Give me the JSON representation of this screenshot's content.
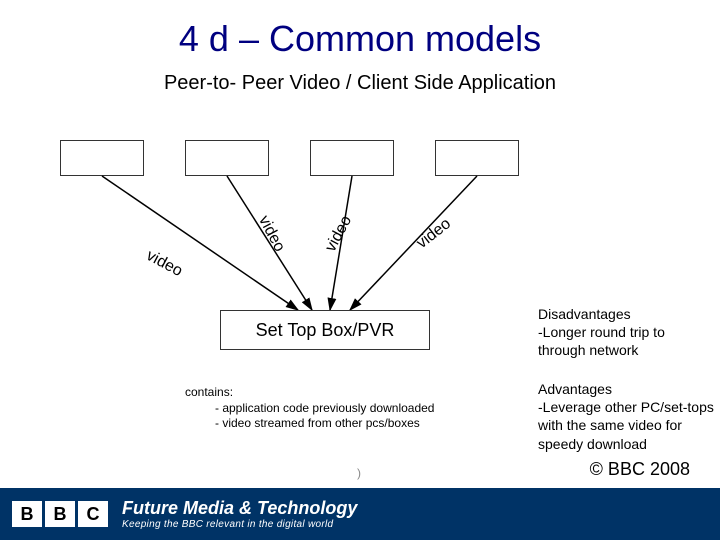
{
  "title": "4 d – Common models",
  "subtitle": "Peer-to- Peer Video / Client Side Application",
  "stb_label": "Set Top Box/PVR",
  "edge_labels": {
    "l1": "video",
    "l2": "video",
    "l3": "video",
    "l4": "video"
  },
  "disadvantages": {
    "heading": "Disadvantages",
    "item1": "-Longer round trip to through network"
  },
  "advantages": {
    "heading": "Advantages",
    "item1": "-Leverage other PC/set-tops with the same video for speedy download"
  },
  "contains": {
    "heading": "contains:",
    "item1": "- application code previously downloaded",
    "item2": "- video streamed from other pcs/boxes"
  },
  "footer": {
    "b1": "B",
    "b2": "B",
    "b3": "C",
    "main": "Future Media & Technology",
    "sub": "Keeping the BBC relevant in the digital world"
  },
  "copyright": "© BBC 2008",
  "page_mark": ")"
}
